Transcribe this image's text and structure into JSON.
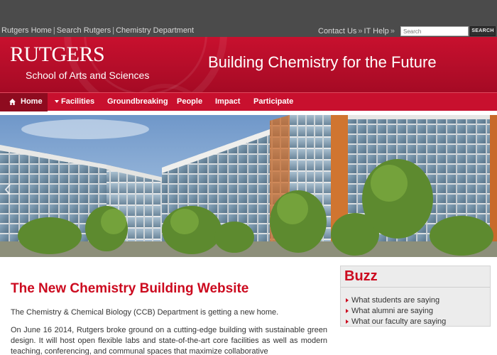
{
  "utility_nav": {
    "left_links": [
      "Rutgers Home",
      "Search Rutgers",
      "Chemistry Department"
    ],
    "separator": "|",
    "right_links": [
      "Contact Us",
      "IT Help"
    ],
    "right_separator": "»",
    "search_placeholder": "Search",
    "search_button": "SEARCH"
  },
  "banner": {
    "wordmark": "RUTGERS",
    "subtitle": "School of Arts and Sciences",
    "tagline": "Building Chemistry for the Future"
  },
  "nav": {
    "items": [
      {
        "label": "Home",
        "icon": "home-icon",
        "active": true
      },
      {
        "label": "Facilities",
        "icon": "caret-down-icon",
        "active": false
      },
      {
        "label": "Groundbreaking",
        "active": false
      },
      {
        "label": "People",
        "active": false
      },
      {
        "label": "Impact",
        "active": false
      },
      {
        "label": "Participate",
        "active": false
      }
    ]
  },
  "hero": {
    "description_icon": "building-rendering-image",
    "prev_arrow": "chevron-left-icon"
  },
  "main": {
    "title": "The New Chemistry Building Website",
    "para1": "The Chemistry & Chemical Biology (CCB) Department is getting a new home.",
    "para2": "On June 16 2014, Rutgers broke ground on a cutting-edge building with sustainable green design. It will host open flexible labs and state-of-the-art core facilities as well as modern teaching, conferencing, and communal spaces that maximize collaborative"
  },
  "buzz": {
    "title": "Buzz",
    "items": [
      "What students are saying",
      "What alumni are saying",
      "What our faculty are saying"
    ]
  },
  "colors": {
    "brand_red": "#cc0a1f",
    "banner_red": "#c8102e",
    "top_bar": "#4b4b4b",
    "active_nav": "#8e0b1f"
  }
}
